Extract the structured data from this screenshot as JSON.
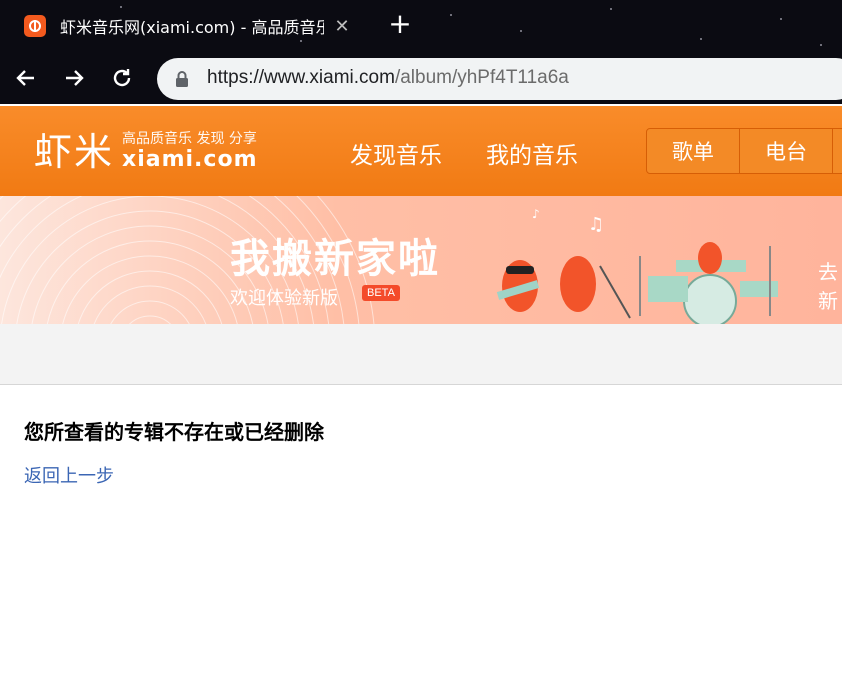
{
  "browser": {
    "tab_title": "虾米音乐网(xiami.com) - 高品质音乐 发现 分享",
    "url_domain": "https://www.xiami.com",
    "url_path": "/album/yhPf4T11a6a"
  },
  "site": {
    "logo_main": "虾米",
    "logo_slogan": "高品质音乐 发现 分享",
    "logo_domain": "xiami.com",
    "nav": [
      "发现音乐",
      "我的音乐"
    ],
    "segments": [
      "歌单",
      "电台"
    ]
  },
  "banner": {
    "title": "我搬新家啦",
    "subtitle": "欢迎体验新版",
    "badge": "BETA",
    "right_text": "去新"
  },
  "content": {
    "error_title": "您所查看的专辑不存在或已经删除",
    "back_link": "返回上一步"
  }
}
